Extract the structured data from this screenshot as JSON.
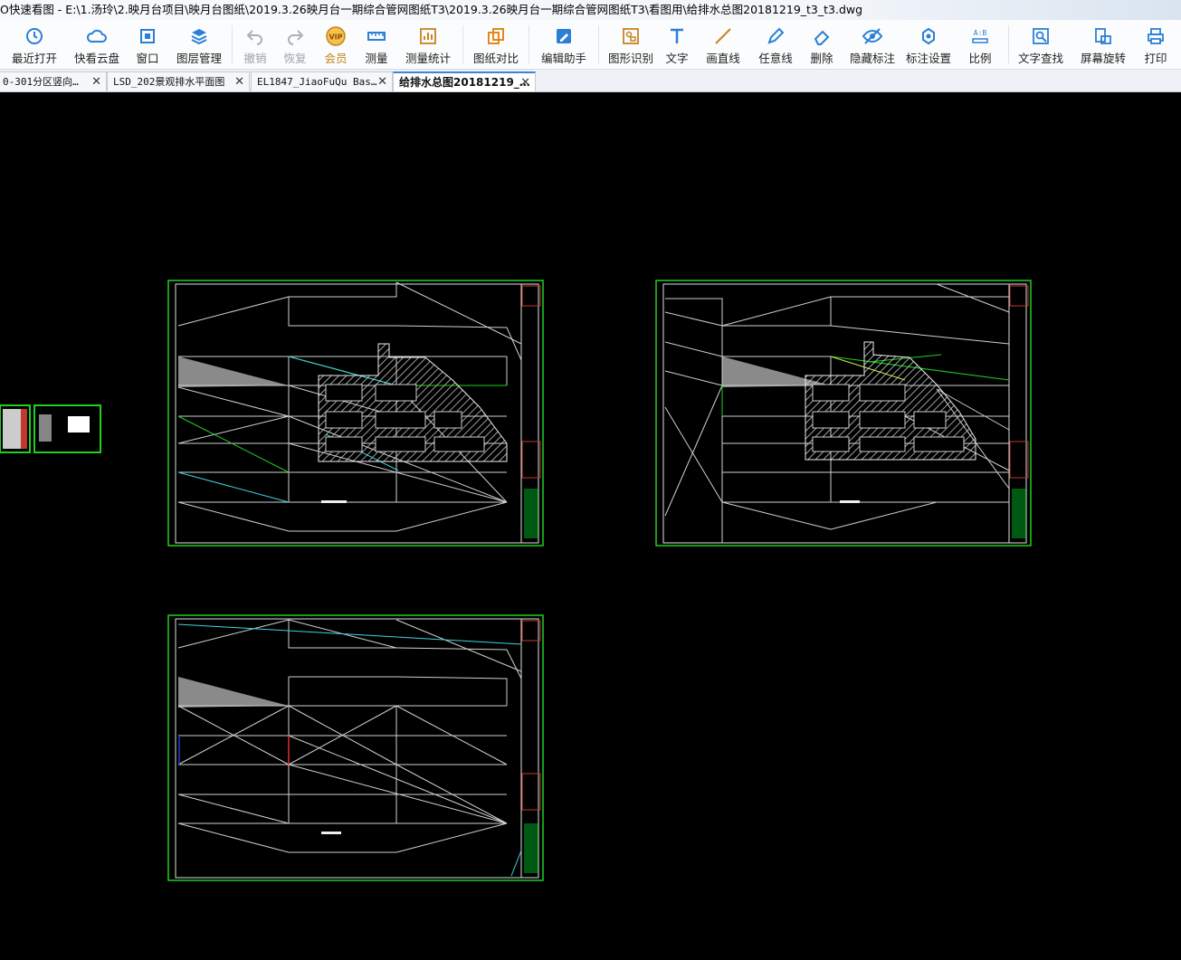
{
  "window": {
    "title": "O快速看图 - E:\\1.汤玲\\2.映月台项目\\映月台图纸\\2019.3.26映月台一期综合管网图纸T3\\2019.3.26映月台一期综合管网图纸T3\\看图用\\给排水总图20181219_t3_t3.dwg"
  },
  "toolbar": {
    "recent": "最近打开",
    "cloud": "快看云盘",
    "window": "窗口",
    "layers": "图层管理",
    "undo": "撤销",
    "redo": "恢复",
    "vip": "会员",
    "measure": "测量",
    "measure_stats": "测量统计",
    "compare": "图纸对比",
    "edit_helper": "编辑助手",
    "shape_recog": "图形识别",
    "text": "文字",
    "line": "画直线",
    "freeline": "任意线",
    "delete": "删除",
    "hide_mark": "隐藏标注",
    "mark_settings": "标注设置",
    "scale": "比例",
    "text_search": "文字查找",
    "rotate": "屏幕旋转",
    "print": "打印"
  },
  "tabs": [
    {
      "label": "0-301分区竖向…",
      "close": "✕"
    },
    {
      "label": "LSD_202景观排水平面图",
      "close": "✕"
    },
    {
      "label": "EL1847_JiaoFuQu Bas…",
      "close": "✕"
    },
    {
      "label": "给排水总图20181219_…",
      "close": "✕"
    }
  ],
  "colors": {
    "frame": "#1fd11f",
    "lines": "#d8d8d8",
    "cyan": "#3fd3e6",
    "green": "#2ecc2e",
    "accent_blue": "#2b7fd6"
  }
}
